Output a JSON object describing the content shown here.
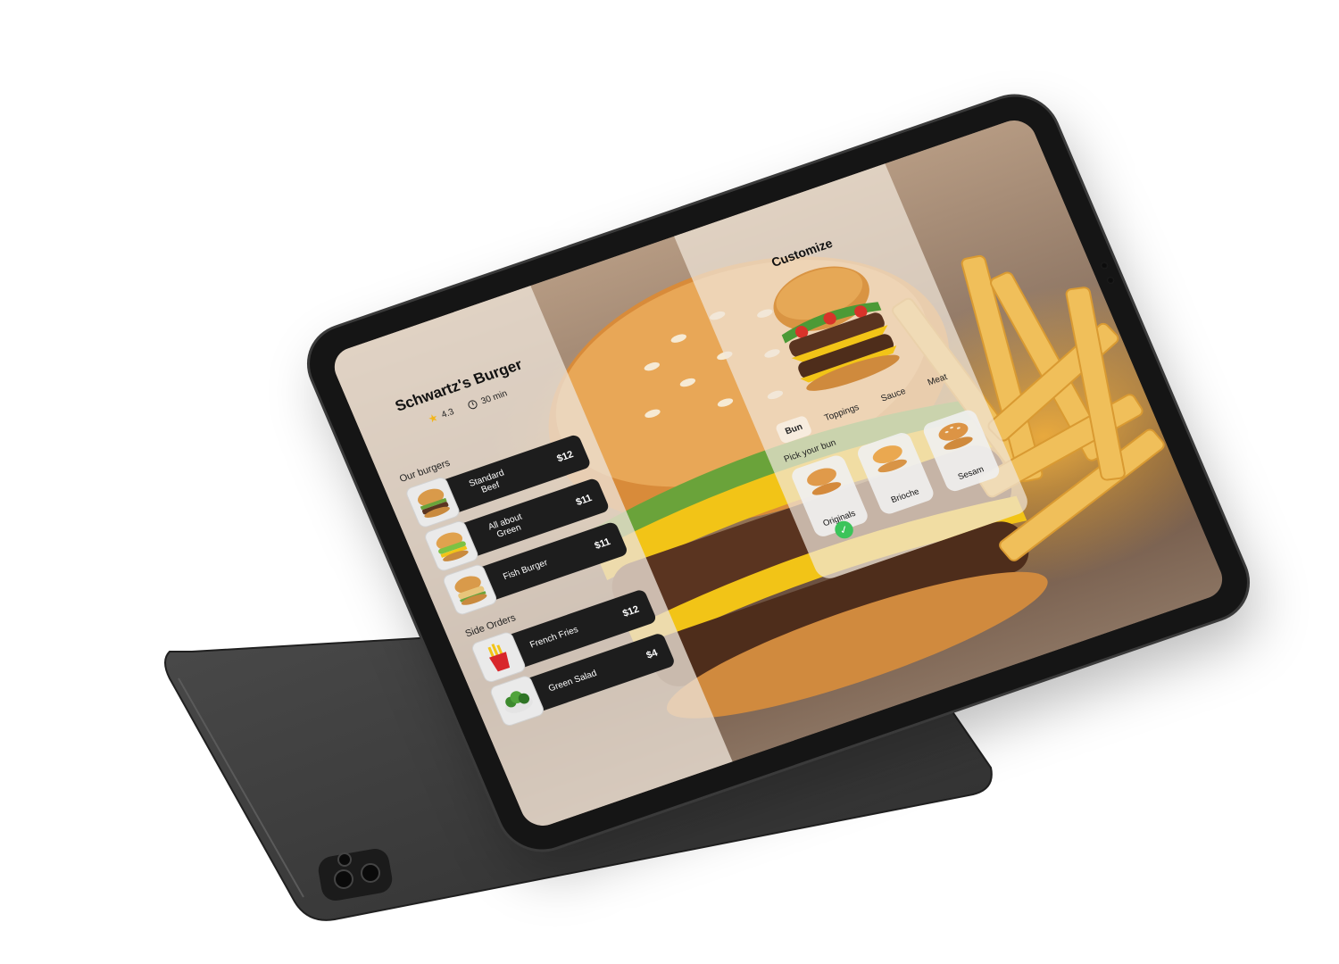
{
  "shop": {
    "name": "Schwartz's Burger",
    "rating": "4.3",
    "time": "30 min"
  },
  "sections": {
    "burgers_label": "Our burgers",
    "sides_label": "Side Orders"
  },
  "burgers": [
    {
      "name": "Standard Beef",
      "price": "$12"
    },
    {
      "name": "All about Green",
      "price": "$11"
    },
    {
      "name": "Fish Burger",
      "price": "$11"
    }
  ],
  "sides": [
    {
      "name": "French Fries",
      "price": "$12"
    },
    {
      "name": "Green Salad",
      "price": "$4"
    }
  ],
  "customize": {
    "title": "Customize",
    "tabs": [
      "Bun",
      "Toppings",
      "Sauce",
      "Meat"
    ],
    "active_tab": "Bun",
    "pick_label": "Pick your bun",
    "buns": [
      "Originals",
      "Brioche",
      "Sesam"
    ],
    "selected_bun": "Originals"
  },
  "colors": {
    "card_dark": "#1d1d1d",
    "star": "#f2b51b",
    "check": "#3bc45a"
  }
}
